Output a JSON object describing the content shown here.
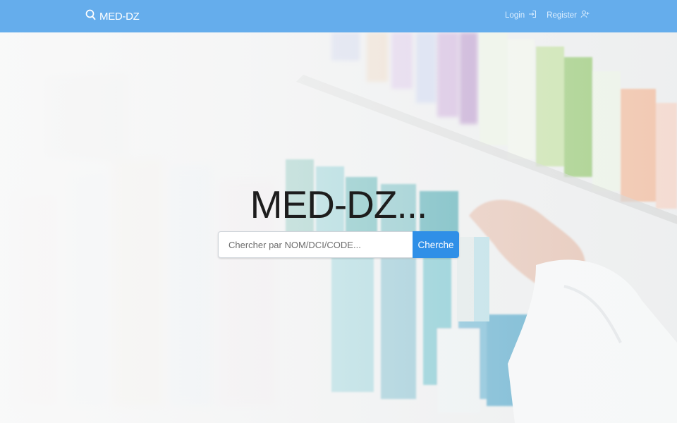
{
  "navbar": {
    "brand": {
      "icon": "search-icon",
      "label": "MED-DZ"
    },
    "login": {
      "label": "Login",
      "icon": "login-icon"
    },
    "register": {
      "label": "Register",
      "icon": "user-plus-icon"
    },
    "color": "#65adec"
  },
  "hero": {
    "background": "pharmacy-shelves-photo",
    "title": "MED-DZ...",
    "search": {
      "placeholder": "Chercher par NOM/DCI/CODE...",
      "value": "",
      "button_label": "Cherche",
      "button_color": "#2f8fe7"
    }
  }
}
